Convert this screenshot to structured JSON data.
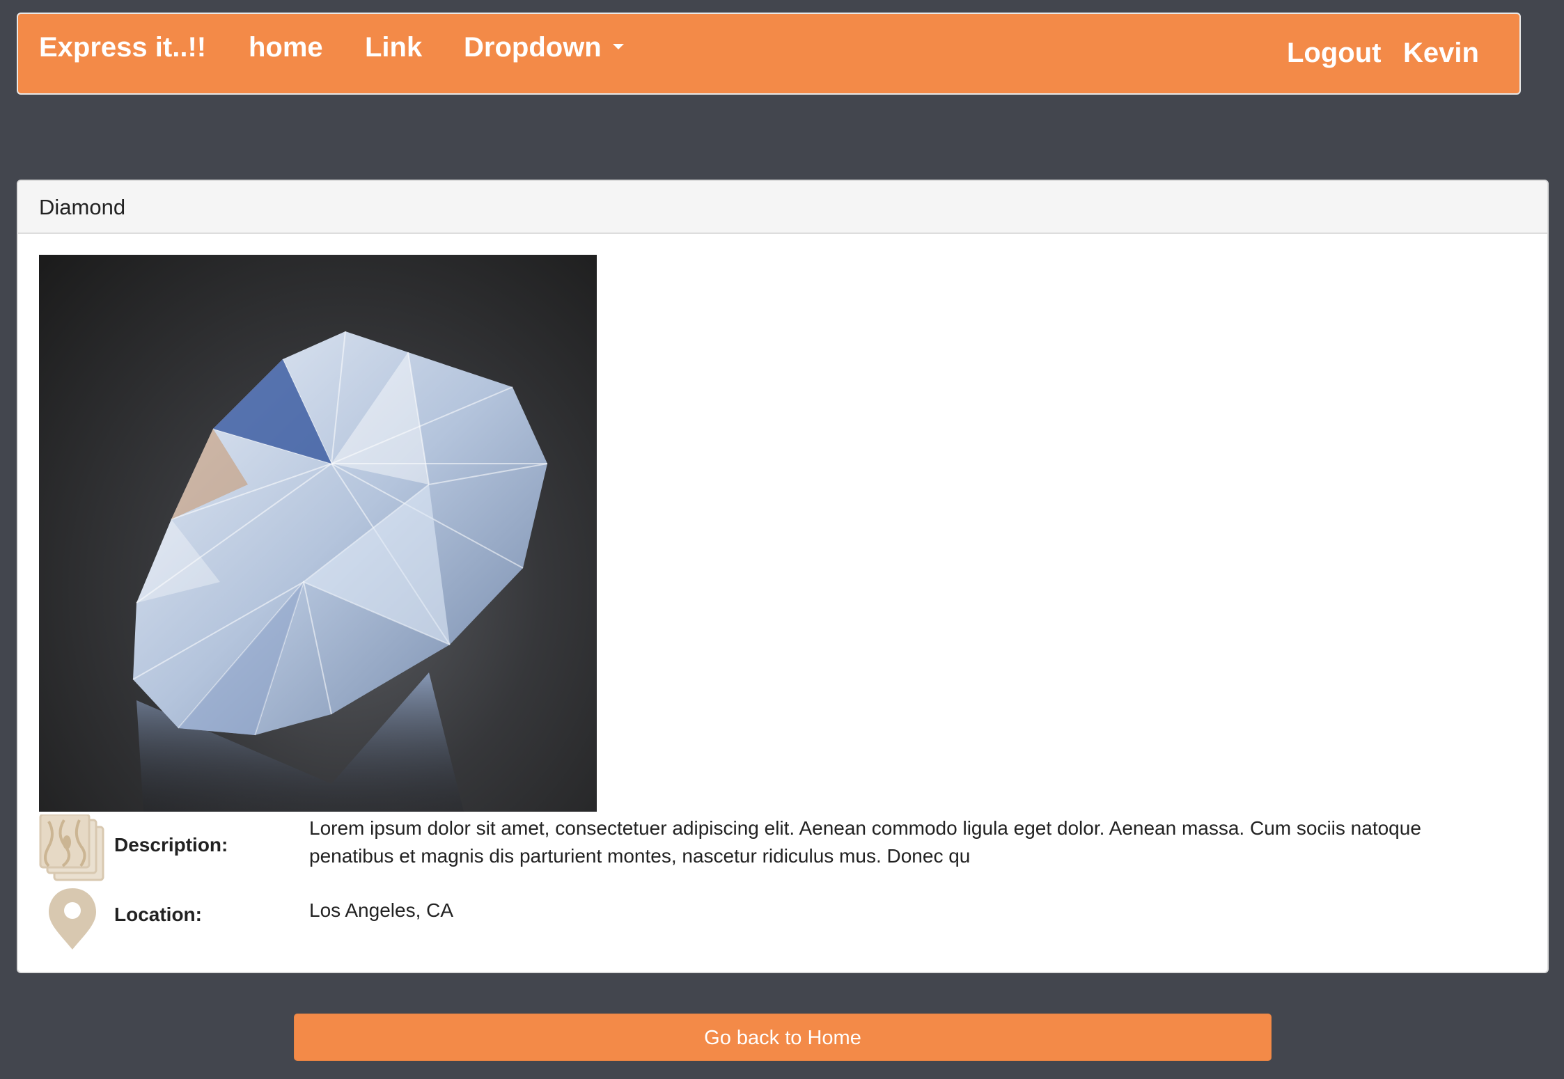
{
  "navbar": {
    "brand": "Express it..!!",
    "links": {
      "home": "home",
      "link": "Link",
      "dropdown": "Dropdown"
    },
    "right": {
      "logout": "Logout",
      "user": "Kevin"
    }
  },
  "panel": {
    "title": "Diamond",
    "image": "diamond-photo",
    "description_label": "Description:",
    "description_value": "Lorem ipsum dolor sit amet, consectetuer adipiscing elit. Aenean commodo ligula eget dolor. Aenean massa. Cum sociis natoque penatibus et magnis dis parturient montes, nascetur ridiculus mus. Donec qu",
    "location_label": "Location:",
    "location_value": "Los Angeles, CA"
  },
  "footer": {
    "home_button": "Go back to Home"
  },
  "colors": {
    "accent": "#f38a48",
    "background": "#43464e",
    "icon": "#d8c8b0"
  }
}
